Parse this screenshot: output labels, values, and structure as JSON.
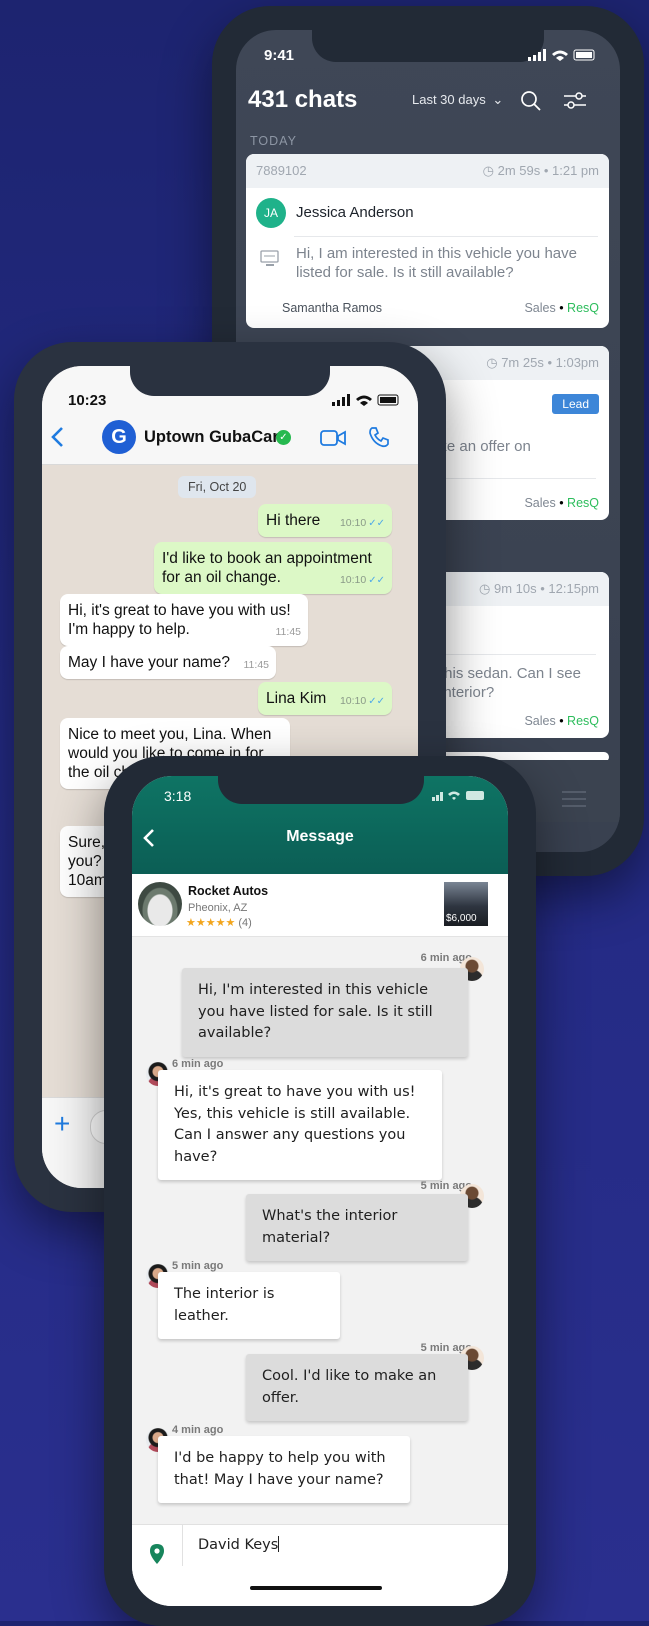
{
  "phone_back": {
    "status_time": "9:41",
    "title": "431 chats",
    "range_filter": "Last 30 days",
    "section_label": "TODAY",
    "cards": [
      {
        "id": "7889102",
        "duration": "2m 59s",
        "time": "1:21 pm",
        "initials": "JA",
        "name": "Jessica Anderson",
        "message": "Hi, I am interested in this vehicle you have listed for sale. Is it still available?",
        "agent": "Samantha Ramos",
        "dept": "Sales",
        "source": "ResQ"
      },
      {
        "duration": "7m 25s",
        "time": "1:03pm",
        "badge": "Lead",
        "message_fragment": "o make an offer on",
        "dept": "Sales",
        "source": "ResQ"
      },
      {
        "duration": "9m 10s",
        "time": "12:15pm",
        "message_fragment_1": "this sedan. Can I see",
        "message_fragment_2": "interior?",
        "dept": "Sales",
        "source": "ResQ"
      }
    ]
  },
  "phone_whatsapp": {
    "status_time": "10:23",
    "contact_name": "Uptown GubaCar",
    "contact_initial": "G",
    "date_chip": "Fri, Oct 20",
    "messages": [
      {
        "dir": "out",
        "text": "Hi there",
        "time": "10:10"
      },
      {
        "dir": "out",
        "text": "I'd like to book an appointment for an oil change.",
        "time": "10:10"
      },
      {
        "dir": "in",
        "text": "Hi, it's great to have you with us! I'm happy to help.",
        "time": "11:45"
      },
      {
        "dir": "in",
        "text": "May I have your name?",
        "time": "11:45"
      },
      {
        "dir": "out",
        "text": "Lina Kim",
        "time": "10:10"
      },
      {
        "dir": "in",
        "text": "Nice to meet you, Lina. When would you like to come in for the oil ch"
      },
      {
        "dir": "in",
        "text": "Sure, you? 10am"
      }
    ]
  },
  "phone_front": {
    "status_time": "3:18",
    "header_title": "Message",
    "dealer": {
      "name": "Rocket Autos",
      "location": "Pheonix, AZ",
      "reviews": "(4)",
      "price": "$6,000"
    },
    "messages": [
      {
        "dir": "out",
        "ago": "6 min ago",
        "text": "Hi, I'm interested in this vehicle you have listed for sale. Is it still available?"
      },
      {
        "dir": "in",
        "ago": "6 min ago",
        "text": "Hi, it's great to have you with us! Yes, this vehicle is still available. Can I answer any questions you have?"
      },
      {
        "dir": "out",
        "ago": "5 min ago",
        "text": "What's the interior material?"
      },
      {
        "dir": "in",
        "ago": "5 min ago",
        "text": "The interior is leather."
      },
      {
        "dir": "out",
        "ago": "5 min ago",
        "text": "Cool. I'd like to make an offer."
      },
      {
        "dir": "in",
        "ago": "4 min ago",
        "text": "I'd be happy to help you with that! May I have your name?"
      }
    ],
    "composer_value": "David Keys"
  },
  "colors": {
    "whatsapp_out": "#dcf8c6",
    "front_header": "#0f6f62",
    "resq_green": "#2dbd5c",
    "lead_badge": "#3d86d8"
  }
}
